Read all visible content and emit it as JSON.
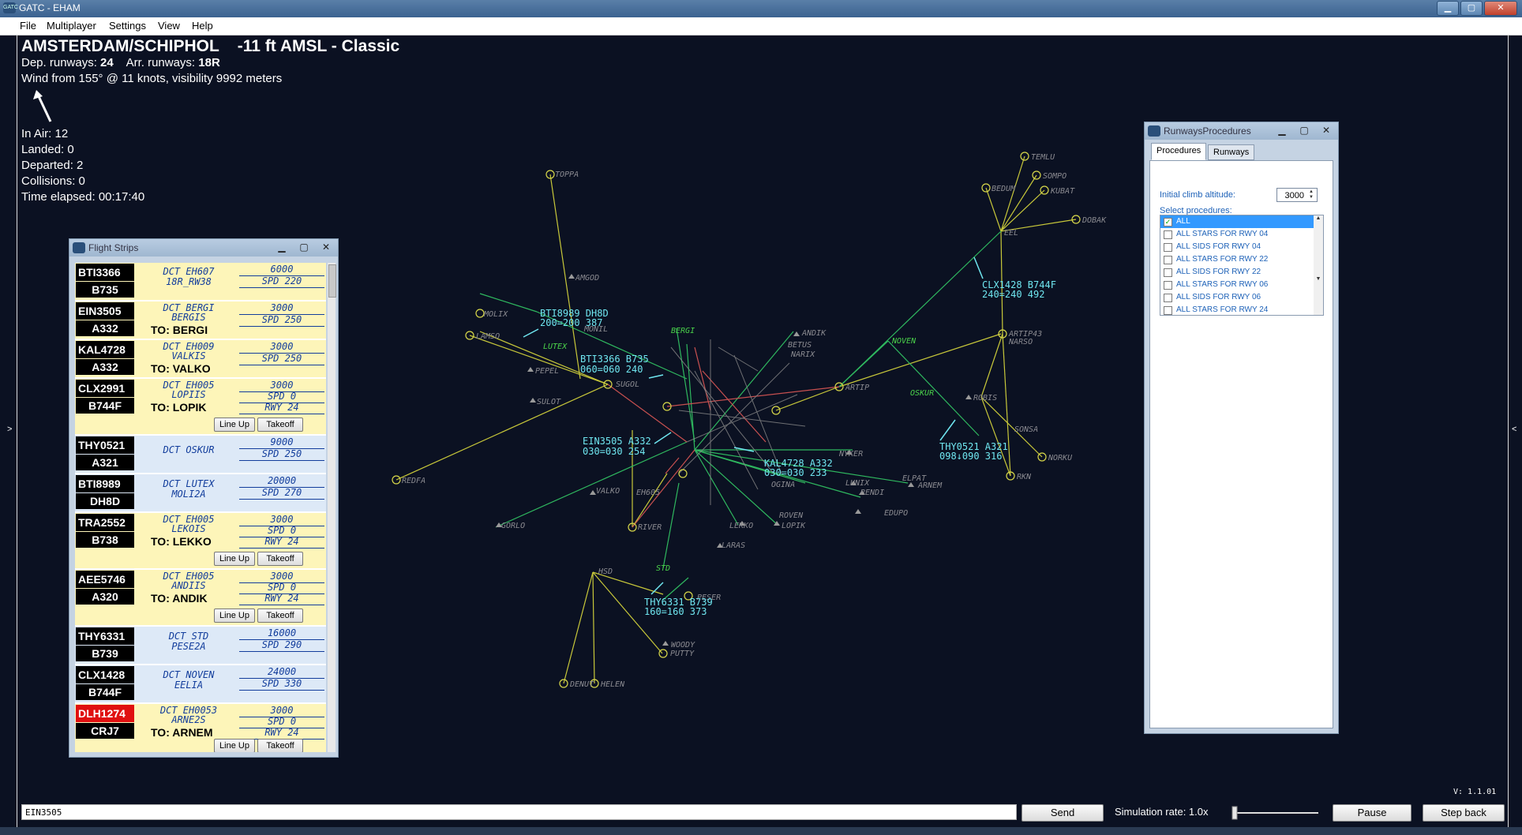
{
  "window": {
    "title": "GATC - EHAM"
  },
  "menu": [
    "File",
    "Multiplayer",
    "Settings",
    "View",
    "Help"
  ],
  "airport": {
    "title": "AMSTERDAM/SCHIPHOL    -11 ft AMSL - Classic",
    "dep_label": "Dep. runways:",
    "dep_value": "24",
    "arr_label": "Arr. runways:",
    "arr_value": "18R",
    "wind": "Wind from 155° @ 11 knots, visibility 9992 meters"
  },
  "stats": {
    "in_air": "In Air: 12",
    "landed": "Landed: 0",
    "departed": "Departed: 2",
    "collisions": "Collisions: 0",
    "elapsed": "Time elapsed: 00:17:40"
  },
  "flight_strips": {
    "title": "Flight Strips",
    "line_up": "Line Up",
    "takeoff": "Takeoff",
    "strips": [
      {
        "callsign": "BTI3366",
        "type": "B735",
        "route1": "DCT EH607",
        "route2": "18R_RW38",
        "alt": "6000",
        "spd": "SPD 220",
        "kind": "arrival"
      },
      {
        "callsign": "EIN3505",
        "type": "A332",
        "route1": "DCT BERGI",
        "route2": "BERGIS",
        "to": "TO: BERGI",
        "alt": "3000",
        "spd": "SPD 250",
        "kind": "departure"
      },
      {
        "callsign": "KAL4728",
        "type": "A332",
        "route1": "DCT EH009",
        "route2": "VALKIS",
        "to": "TO: VALKO",
        "alt": "3000",
        "spd": "SPD 250",
        "kind": "departure"
      },
      {
        "callsign": "CLX2991",
        "type": "B744F",
        "route1": "DCT EH005",
        "route2": "LOPIIS",
        "to": "TO: LOPIK",
        "alt": "3000",
        "spd": "SPD 0",
        "rwy": "RWY 24",
        "kind": "departure"
      },
      {
        "callsign": "THY0521",
        "type": "A321",
        "route1": "DCT OSKUR",
        "route2": "",
        "alt": "9000",
        "spd": "SPD 250",
        "kind": "arrival"
      },
      {
        "callsign": "BTI8989",
        "type": "DH8D",
        "route1": "DCT LUTEX",
        "route2": "MOLI2A",
        "alt": "20000",
        "spd": "SPD 270",
        "kind": "arrival"
      },
      {
        "callsign": "TRA2552",
        "type": "B738",
        "route1": "DCT EH005",
        "route2": "LEKOIS",
        "to": "TO: LEKKO",
        "alt": "3000",
        "spd": "SPD 0",
        "rwy": "RWY 24",
        "kind": "departure"
      },
      {
        "callsign": "AEE5746",
        "type": "A320",
        "route1": "DCT EH005",
        "route2": "ANDIIS",
        "to": "TO: ANDIK",
        "alt": "3000",
        "spd": "SPD 0",
        "rwy": "RWY 24",
        "kind": "departure"
      },
      {
        "callsign": "THY6331",
        "type": "B739",
        "route1": "DCT STD",
        "route2": "PESE2A",
        "alt": "16000",
        "spd": "SPD 290",
        "kind": "arrival"
      },
      {
        "callsign": "CLX1428",
        "type": "B744F",
        "route1": "DCT NOVEN",
        "route2": "EELIA",
        "alt": "24000",
        "spd": "SPD 330",
        "kind": "arrival"
      },
      {
        "callsign": "DLH1274",
        "type": "CRJ7",
        "route1": "DCT EH0053",
        "route2": "ARNE2S",
        "to": "TO: ARNEM",
        "alt": "3000",
        "spd": "SPD 0",
        "rwy": "RWY 24",
        "kind": "departure"
      }
    ]
  },
  "procedures_window": {
    "title": "RunwaysProcedures",
    "tabs": [
      "Procedures",
      "Runways"
    ],
    "initial_climb_label": "Initial climb altitude:",
    "initial_climb_value": "3000",
    "select_label": "Select procedures:",
    "items": [
      {
        "label": "ALL",
        "checked": true
      },
      {
        "label": "ALL STARS FOR RWY 04",
        "checked": false
      },
      {
        "label": "ALL SIDS FOR RWY 04",
        "checked": false
      },
      {
        "label": "ALL STARS FOR RWY 22",
        "checked": false
      },
      {
        "label": "ALL SIDS FOR RWY 22",
        "checked": false
      },
      {
        "label": "ALL STARS FOR RWY 06",
        "checked": false
      },
      {
        "label": "ALL SIDS FOR RWY 06",
        "checked": false
      },
      {
        "label": "ALL STARS FOR RWY 24",
        "checked": false
      }
    ]
  },
  "bottom": {
    "command_value": "EIN3505",
    "send": "Send",
    "sim_rate": "Simulation rate: 1.0x",
    "pause": "Pause",
    "step_back": "Step back",
    "version": "V: 1.1.01"
  },
  "map": {
    "fixes": [
      "TOPPA",
      "AMGOD",
      "MOLIX",
      "LAMSO",
      "PEPEL",
      "SULOT",
      "REDFA",
      "GORLO",
      "SUGOL",
      "RIVER",
      "STD",
      "PESER",
      "HSD",
      "WOODY",
      "PUTTY",
      "DENUT",
      "HELEN",
      "BERGI",
      "LUTEX",
      "ANDIK",
      "BETUS",
      "NARIX",
      "ARTIP",
      "NOVEN",
      "OSKUR",
      "ROBIS",
      "SONSA",
      "NORKU",
      "RKN",
      "ARTIP43",
      "NARSO",
      "TEMLU",
      "SOMPO",
      "KUBAT",
      "BEDUM",
      "DOBAK",
      "EEL",
      "NYKER",
      "LUNIX",
      "RENDI",
      "EDUPO",
      "ELPAT",
      "ARNEM",
      "LEKKO",
      "LOPIK",
      "LARAS",
      "VALKO",
      "EH605",
      "OGINA",
      "ROVEN",
      "MONIL"
    ],
    "aircraft_labels": [
      {
        "line1": "BTI8989  DH8D",
        "line2": "200=200  387"
      },
      {
        "line1": "BTI3366  B735",
        "line2": "060=060  240"
      },
      {
        "line1": "EIN3505  A332",
        "line2": "030=030  254"
      },
      {
        "line1": "KAL4728  A332",
        "line2": "030=030  233"
      },
      {
        "line1": "CLX1428  B744F",
        "line2": "240=240  492"
      },
      {
        "line1": "THY0521  A321",
        "line2": "098↓090  316"
      },
      {
        "line1": "THY6331  B739",
        "line2": "160=160  373"
      }
    ]
  }
}
